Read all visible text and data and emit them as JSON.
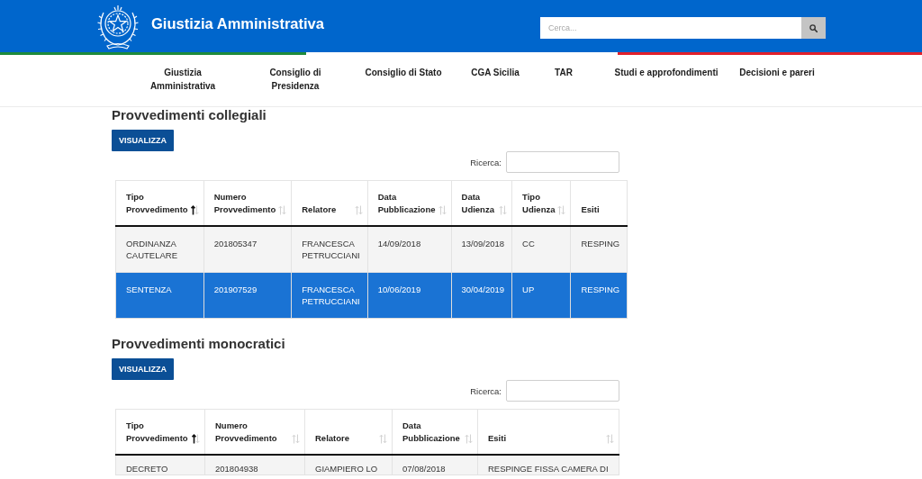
{
  "header": {
    "title": "Giustizia Amministrativa",
    "search": {
      "placeholder": "Cerca..."
    }
  },
  "nav": {
    "items": [
      "Giustizia Amministrativa",
      "Consiglio di Presidenza",
      "Consiglio di Stato",
      "CGA Sicilia",
      "TAR",
      "Studi e approfondimenti",
      "Decisioni e pareri"
    ]
  },
  "sections": [
    {
      "title": "Provvedimenti collegiali",
      "button": "VISUALIZZA",
      "filter_label": "Ricerca:",
      "table": {
        "columns": [
          {
            "label": "Tipo Provvedimento",
            "sortable": true,
            "sorted": true
          },
          {
            "label": "Numero Provvedimento",
            "sortable": true,
            "sorted": false
          },
          {
            "label": "Relatore",
            "sortable": true,
            "sorted": false
          },
          {
            "label": "Data Pubblicazione",
            "sortable": true,
            "sorted": false
          },
          {
            "label": "Data Udienza",
            "sortable": true,
            "sorted": false
          },
          {
            "label": "Tipo Udienza",
            "sortable": true,
            "sorted": false
          },
          {
            "label": "Esiti",
            "sortable": false
          }
        ],
        "rows": [
          {
            "selected": false,
            "cells": [
              "ORDINANZA CAUTELARE",
              "201805347",
              "FRANCESCA PETRUCCIANI",
              "14/09/2018",
              "13/09/2018",
              "CC",
              "RESPING"
            ]
          },
          {
            "selected": true,
            "cells": [
              "SENTENZA",
              "201907529",
              "FRANCESCA PETRUCCIANI",
              "10/06/2019",
              "30/04/2019",
              "UP",
              "RESPING"
            ]
          }
        ]
      }
    },
    {
      "title": "Provvedimenti monocratici",
      "button": "VISUALIZZA",
      "filter_label": "Ricerca:",
      "table": {
        "columns": [
          {
            "label": "Tipo Provvedimento",
            "sortable": true,
            "sorted": true
          },
          {
            "label": "Numero Provvedimento",
            "sortable": true,
            "sorted": false
          },
          {
            "label": "Relatore",
            "sortable": true,
            "sorted": false
          },
          {
            "label": "Data Pubblicazione",
            "sortable": true,
            "sorted": false
          },
          {
            "label": "Esiti",
            "sortable": true,
            "sorted": false
          }
        ],
        "rows": [
          {
            "selected": false,
            "cells": [
              "DECRETO",
              "201804938",
              "GIAMPIERO LO",
              "07/08/2018",
              "RESPINGE FISSA CAMERA DI"
            ]
          }
        ]
      }
    }
  ]
}
